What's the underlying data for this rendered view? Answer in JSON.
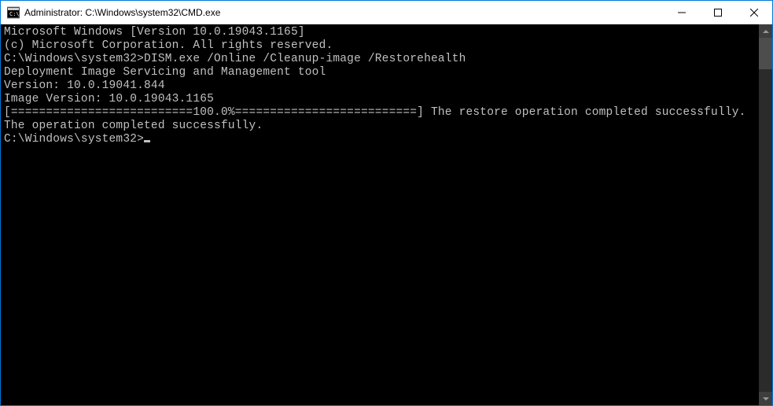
{
  "window": {
    "title": "Administrator: C:\\Windows\\system32\\CMD.exe"
  },
  "console": {
    "lines": {
      "l0": "Microsoft Windows [Version 10.0.19043.1165]",
      "l1": "(c) Microsoft Corporation. All rights reserved.",
      "l2": "",
      "l3_prompt": "C:\\Windows\\system32>",
      "l3_cmd": "DISM.exe /Online /Cleanup-image /Restorehealth",
      "l4": "",
      "l5": "Deployment Image Servicing and Management tool",
      "l6": "Version: 10.0.19041.844",
      "l7": "",
      "l8": "Image Version: 10.0.19043.1165",
      "l9": "",
      "l10": "[==========================100.0%==========================] The restore operation completed successfully.",
      "l11": "The operation completed successfully.",
      "l12": "",
      "l13_prompt": "C:\\Windows\\system32>"
    }
  }
}
